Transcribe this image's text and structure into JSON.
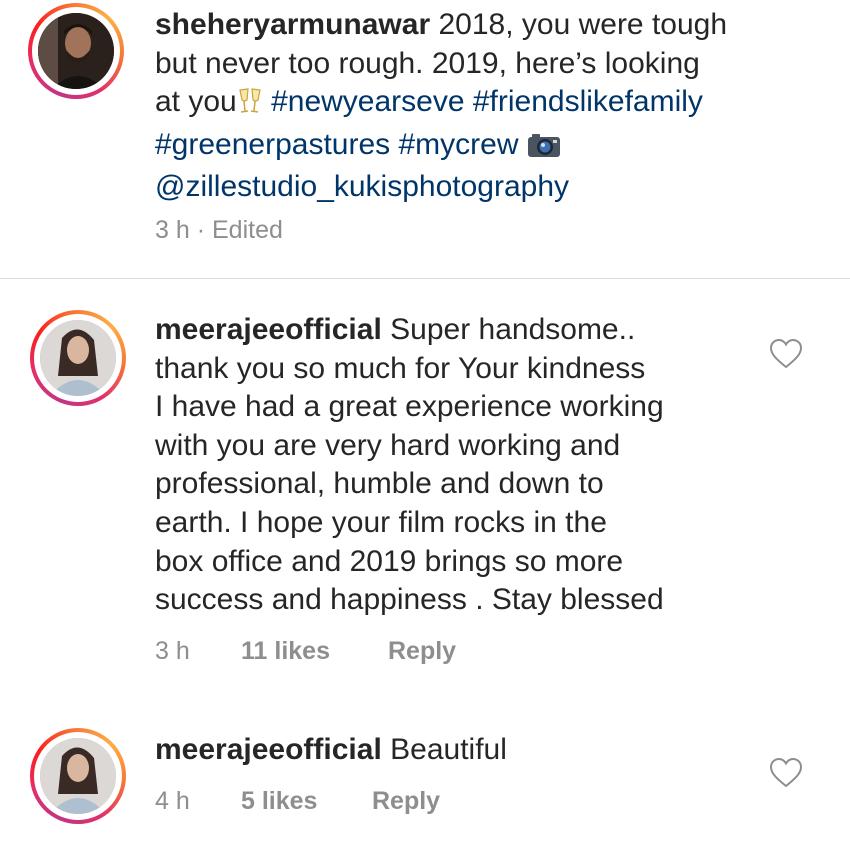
{
  "caption": {
    "username": "sheheryarmunawar",
    "line1_text": " 2018, you were tough",
    "line2_text": "but never too rough.  2019, here’s looking",
    "line3_text": "at you",
    "line3_emoji": "clinking-glasses-icon",
    "line3_hashtags": " #newyearseve #friendslikefamily",
    "line4_hashtags": "#greenerpastures #mycrew ",
    "line4_emoji": "camera-icon",
    "line5_mention": "@zillestudio_kukisphotography",
    "time": "3 h",
    "separator": " · ",
    "edited": "Edited"
  },
  "comments": [
    {
      "username": "meerajeeofficial",
      "lines": [
        " Super handsome..",
        "thank you so much for Your kindness",
        "I have had a great experience working",
        "with you are very hard working and",
        "professional, humble and down to",
        "earth. I hope your film rocks in the",
        "box office and 2019 brings so more",
        "success and happiness . Stay blessed"
      ],
      "time": "3 h",
      "likes": "11 likes",
      "reply": "Reply",
      "like_icon": "heart-outline-icon"
    },
    {
      "username": "meerajeeofficial",
      "lines": [
        " Beautiful"
      ],
      "time": "4 h",
      "likes": "5 likes",
      "reply": "Reply",
      "like_icon": "heart-outline-icon"
    }
  ],
  "colors": {
    "text": "#262626",
    "hashtag": "#003569",
    "meta": "#8e8e8e",
    "divider": "#dbdbdb"
  }
}
